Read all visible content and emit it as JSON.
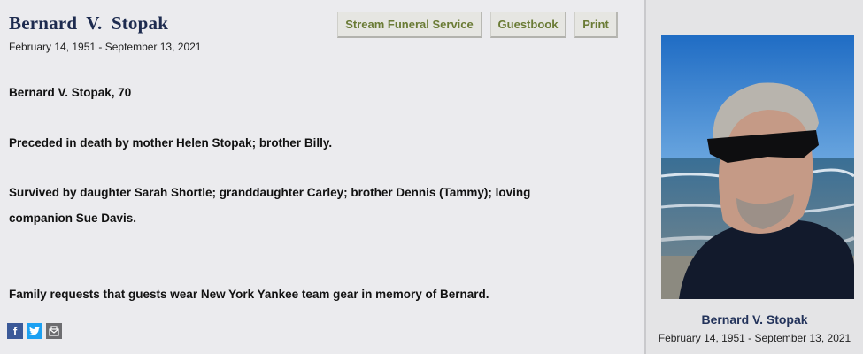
{
  "obituary": {
    "name": "Bernard V. Stopak",
    "dates": "February 14, 1951 -  September 13, 2021",
    "paragraphs": [
      "Bernard V. Stopak, 70",
      "Preceded in death by mother Helen Stopak; brother Billy.",
      "Survived by daughter Sarah Shortle; granddaughter Carley; brother Dennis (Tammy); loving companion Sue Davis.",
      "Family requests that guests wear New York Yankee team gear in memory of Bernard."
    ]
  },
  "actions": {
    "stream_label": "Stream Funeral Service",
    "guestbook_label": "Guestbook",
    "print_label": "Print"
  },
  "share": {
    "icons": [
      "facebook-icon",
      "twitter-icon",
      "email-icon"
    ]
  },
  "sidebar": {
    "name": "Bernard V. Stopak",
    "dates": "February 14, 1951 - September 13, 2021"
  },
  "colors": {
    "title": "#1d2b4f",
    "button_text": "#6a7b35",
    "facebook": "#3b5998",
    "twitter": "#1da1f2"
  }
}
